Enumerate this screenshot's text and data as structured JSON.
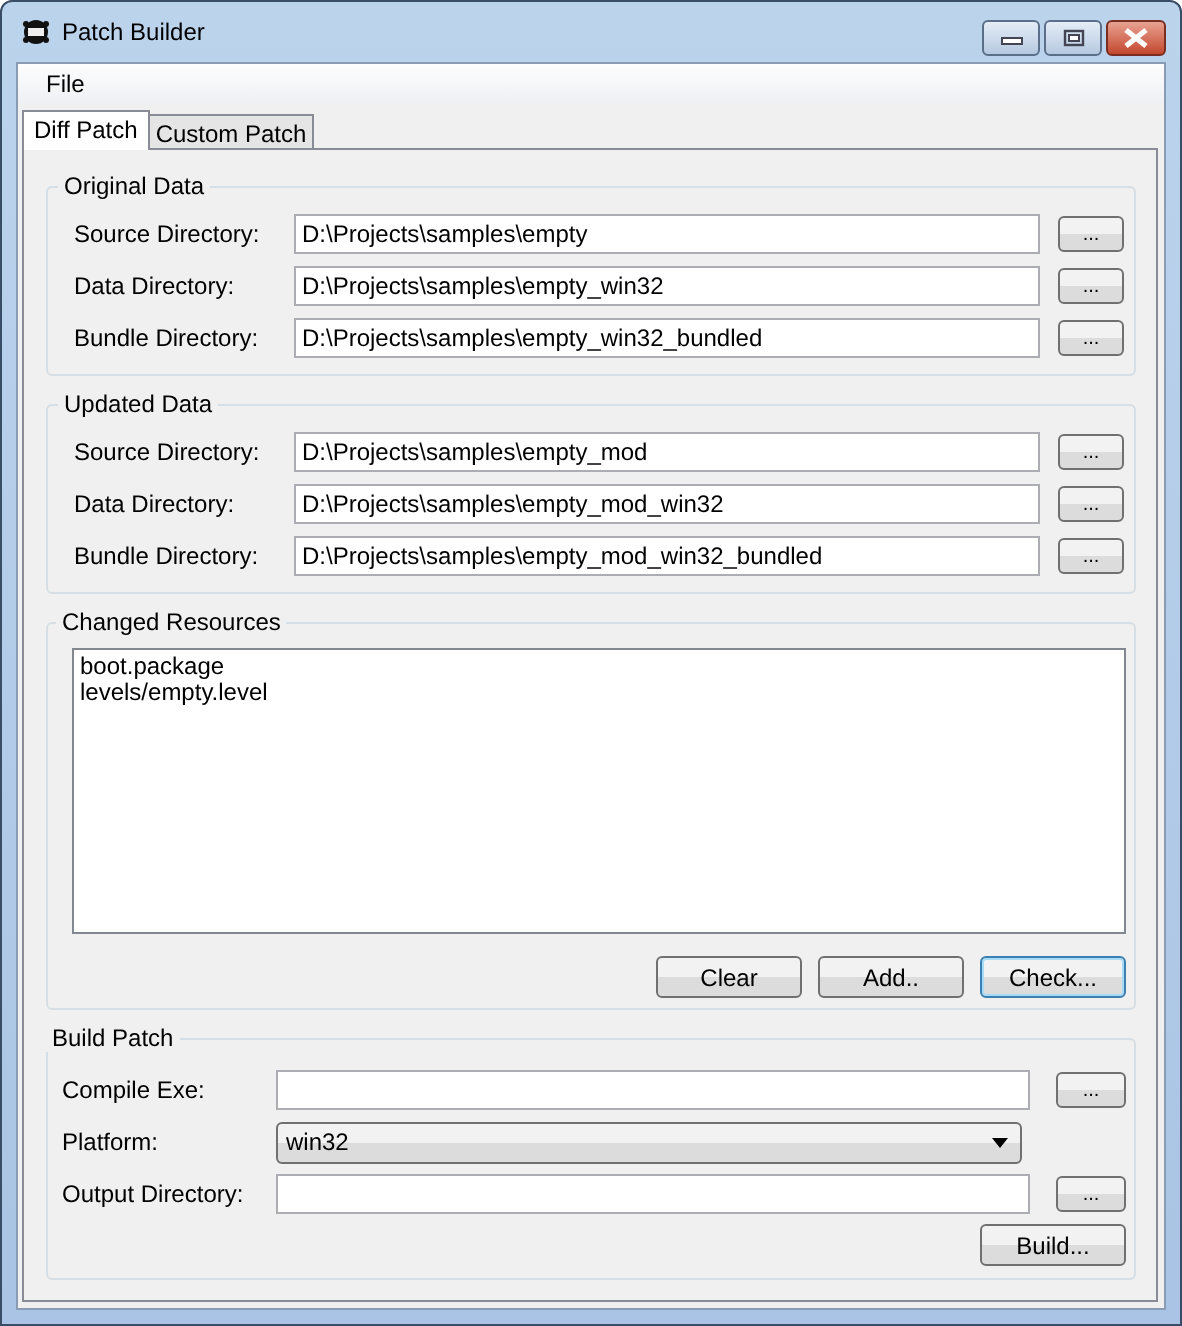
{
  "window": {
    "title": "Patch Builder"
  },
  "menu": [
    "File"
  ],
  "tabs": [
    {
      "label": "Diff Patch",
      "selected": true
    },
    {
      "label": "Custom Patch",
      "selected": false
    }
  ],
  "original_data": {
    "title": "Original Data",
    "rows": [
      {
        "label": "Source Directory:",
        "value": "D:\\Projects\\samples\\empty",
        "button": "..."
      },
      {
        "label": "Data Directory:",
        "value": "D:\\Projects\\samples\\empty_win32",
        "button": "..."
      },
      {
        "label": "Bundle Directory:",
        "value": "D:\\Projects\\samples\\empty_win32_bundled",
        "button": "..."
      }
    ]
  },
  "updated_data": {
    "title": "Updated Data",
    "rows": [
      {
        "label": "Source Directory:",
        "value": "D:\\Projects\\samples\\empty_mod",
        "button": "..."
      },
      {
        "label": "Data Directory:",
        "value": "D:\\Projects\\samples\\empty_mod_win32",
        "button": "..."
      },
      {
        "label": "Bundle Directory:",
        "value": "D:\\Projects\\samples\\empty_mod_win32_bundled",
        "button": "..."
      }
    ]
  },
  "changed_resources": {
    "title": "Changed Resources",
    "items": [
      "boot.package",
      "levels/empty.level"
    ],
    "buttons": [
      {
        "label": "Clear",
        "focused": false
      },
      {
        "label": "Add..",
        "focused": false
      },
      {
        "label": "Check...",
        "focused": true
      }
    ]
  },
  "build_patch": {
    "title": "Build Patch",
    "rows": [
      {
        "kind": "text",
        "label": "Compile Exe:",
        "value": "",
        "button": "..."
      },
      {
        "kind": "dropdown",
        "label": "Platform:",
        "value": "win32"
      },
      {
        "kind": "text",
        "label": "Output Directory:",
        "value": "",
        "button": "..."
      }
    ],
    "build_button": "Build..."
  }
}
